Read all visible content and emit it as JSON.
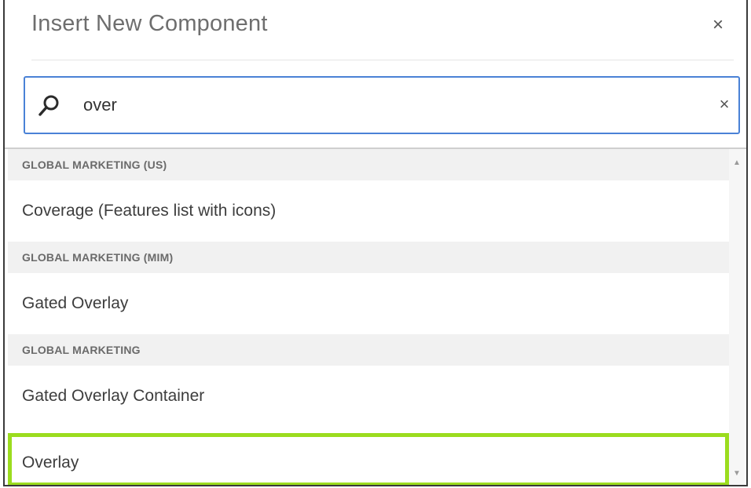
{
  "dialog": {
    "title": "Insert New Component",
    "close_glyph": "×"
  },
  "search": {
    "value": "over",
    "icon": "search-icon",
    "clear_glyph": "×"
  },
  "results": {
    "groups": [
      {
        "header": "GLOBAL MARKETING (US)",
        "items": [
          "Coverage (Features list with icons)"
        ]
      },
      {
        "header": "GLOBAL MARKETING (MIM)",
        "items": [
          "Gated Overlay"
        ]
      },
      {
        "header": "GLOBAL MARKETING",
        "items": [
          "Gated Overlay Container",
          "Overlay"
        ]
      }
    ],
    "selected": "Overlay",
    "highlight_color": "#9bdc1e"
  },
  "scrollbar": {
    "up_glyph": "▲",
    "down_glyph": "▼"
  }
}
